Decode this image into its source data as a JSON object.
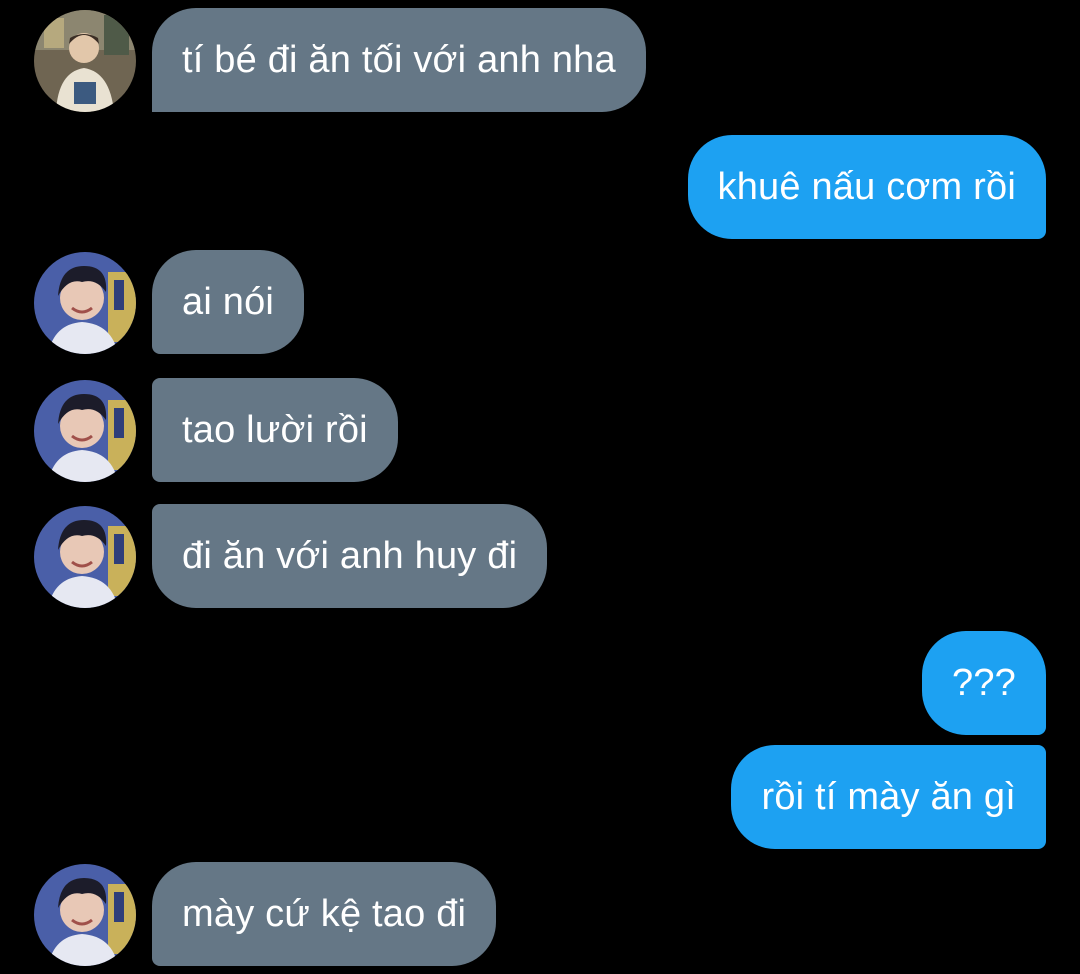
{
  "colors": {
    "background": "#000000",
    "incoming_bubble": "#657786",
    "outgoing_bubble": "#1da1f2",
    "text": "#ffffff"
  },
  "messages": [
    {
      "sender": "them",
      "avatar": "avatar-1",
      "text": "tí bé đi ăn tối với anh nha"
    },
    {
      "sender": "me",
      "text": "khuê nấu cơm rồi"
    },
    {
      "sender": "them",
      "avatar": "avatar-2",
      "text": "ai nói"
    },
    {
      "sender": "them",
      "avatar": "avatar-2",
      "text": "tao lười rồi"
    },
    {
      "sender": "them",
      "avatar": "avatar-2",
      "text": "đi ăn với anh huy đi"
    },
    {
      "sender": "me",
      "text": "???"
    },
    {
      "sender": "me",
      "text": "rồi tí mày ăn gì"
    },
    {
      "sender": "them",
      "avatar": "avatar-2",
      "text": "mày cứ kệ tao đi"
    }
  ]
}
